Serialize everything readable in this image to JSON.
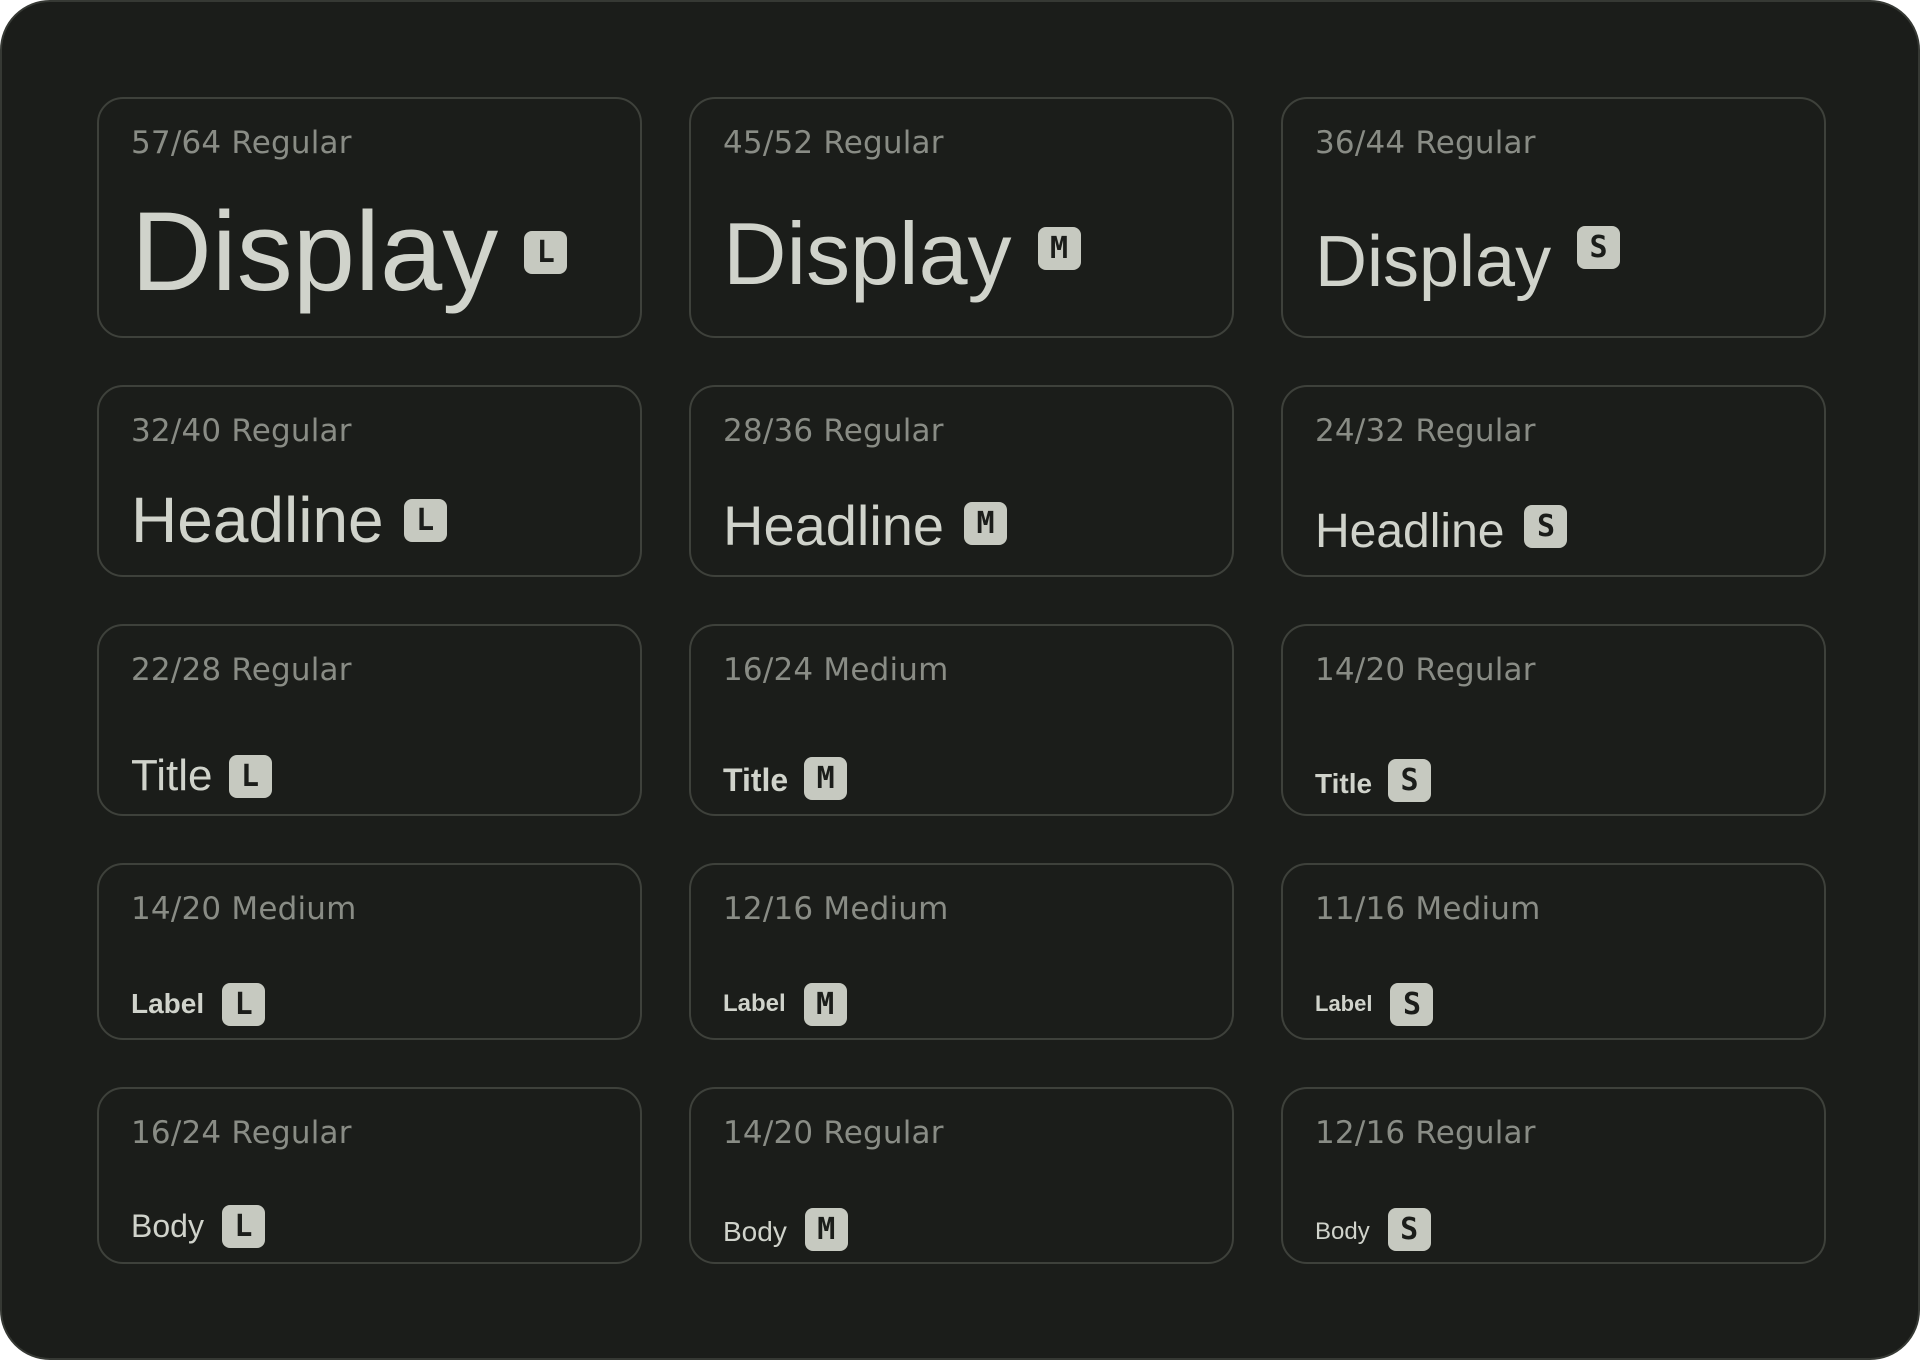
{
  "colors": {
    "background": "#1b1d1a",
    "card_border": "#3e413b",
    "spec_text": "#898c85",
    "sample_text": "#d0d3cb",
    "badge_bg": "#c6c9c0",
    "badge_text": "#1b1d1a"
  },
  "rows": [
    {
      "cards": [
        {
          "spec": "57/64 Regular",
          "name": "Display",
          "badge": "L"
        },
        {
          "spec": "45/52 Regular",
          "name": "Display",
          "badge": "M"
        },
        {
          "spec": "36/44 Regular",
          "name": "Display",
          "badge": "S"
        }
      ]
    },
    {
      "cards": [
        {
          "spec": "32/40 Regular",
          "name": "Headline",
          "badge": "L"
        },
        {
          "spec": "28/36 Regular",
          "name": "Headline",
          "badge": "M"
        },
        {
          "spec": "24/32 Regular",
          "name": "Headline",
          "badge": "S"
        }
      ]
    },
    {
      "cards": [
        {
          "spec": "22/28 Regular",
          "name": "Title",
          "badge": "L"
        },
        {
          "spec": "16/24 Medium",
          "name": "Title",
          "badge": "M"
        },
        {
          "spec": "14/20 Regular",
          "name": "Title",
          "badge": "S"
        }
      ]
    },
    {
      "cards": [
        {
          "spec": "14/20 Medium",
          "name": "Label",
          "badge": "L"
        },
        {
          "spec": "12/16 Medium",
          "name": "Label",
          "badge": "M"
        },
        {
          "spec": "11/16 Medium",
          "name": "Label",
          "badge": "S"
        }
      ]
    },
    {
      "cards": [
        {
          "spec": "16/24 Regular",
          "name": "Body",
          "badge": "L"
        },
        {
          "spec": "14/20 Regular",
          "name": "Body",
          "badge": "M"
        },
        {
          "spec": "12/16 Regular",
          "name": "Body",
          "badge": "S"
        }
      ]
    }
  ]
}
